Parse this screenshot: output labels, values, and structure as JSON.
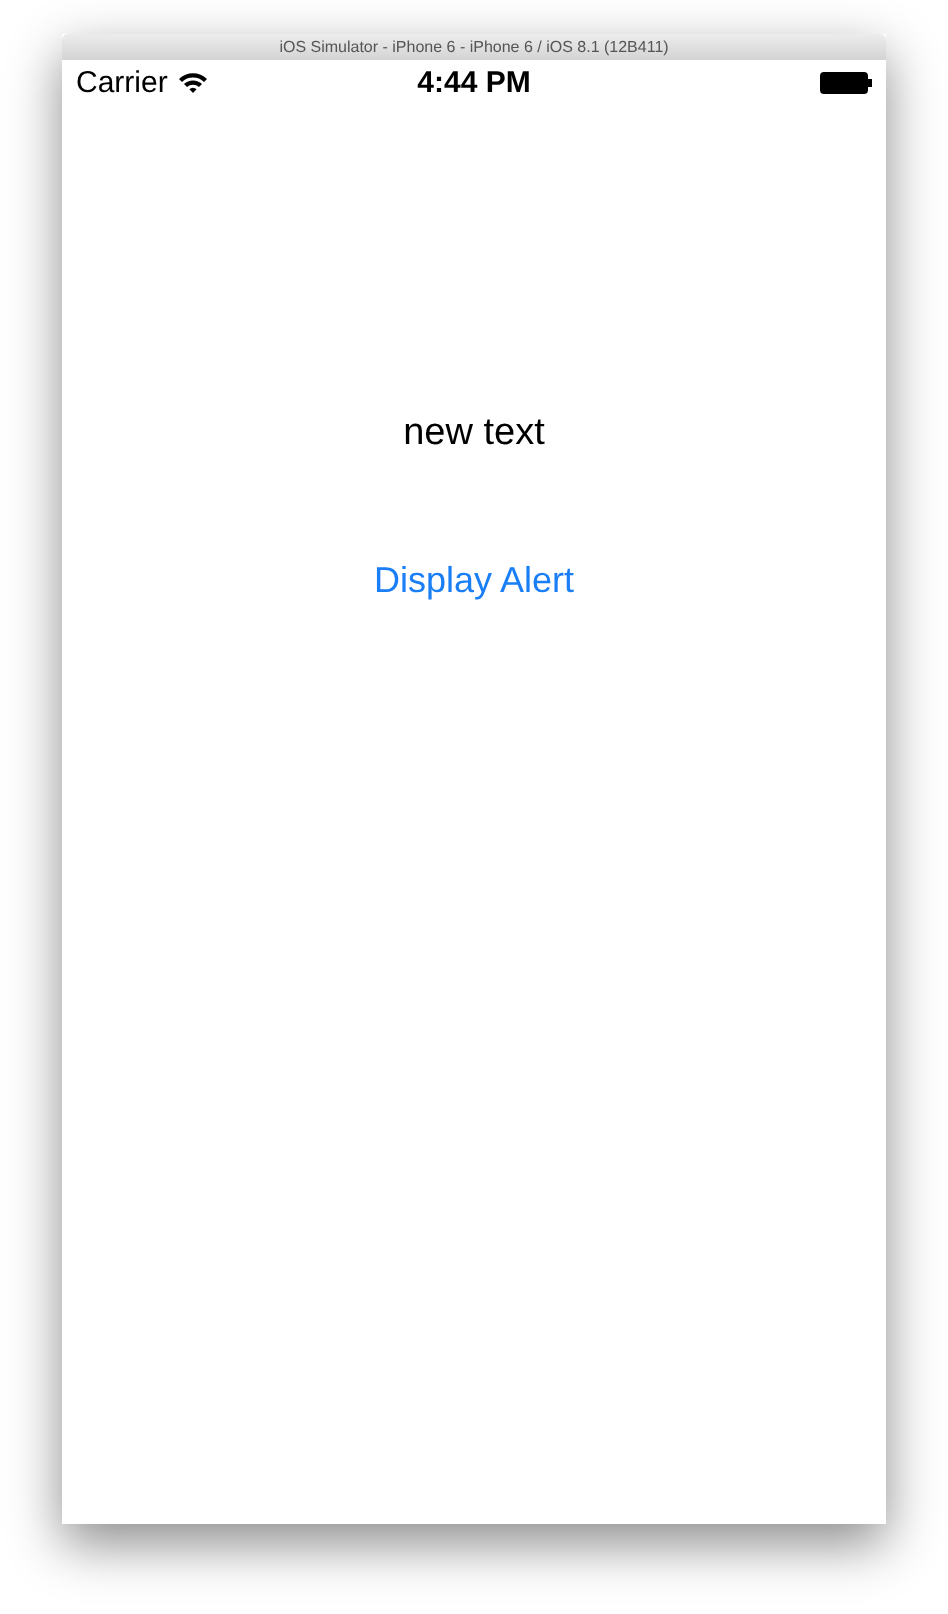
{
  "window": {
    "title": "iOS Simulator - iPhone 6 - iPhone 6 / iOS 8.1 (12B411)"
  },
  "status_bar": {
    "carrier": "Carrier",
    "time": "4:44 PM"
  },
  "screen": {
    "label": "new text",
    "button": "Display Alert"
  }
}
